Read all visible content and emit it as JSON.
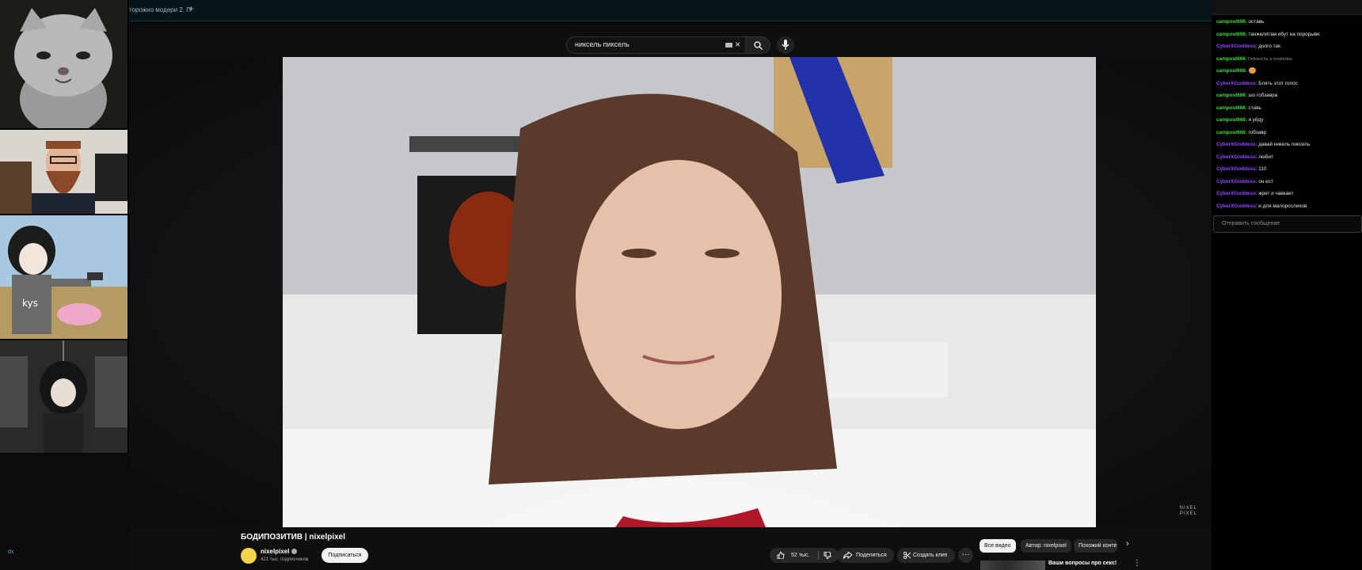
{
  "browser": {
    "tab_label": "торожно модери 2. П",
    "tab_add": "+"
  },
  "header": {
    "search_value": "никсель пиксель",
    "clear_icon": "×"
  },
  "video": {
    "watermark_line1": "NIXEL",
    "watermark_line2": "PIXEL",
    "title": "БОДИПОЗИТИВ | nixelpixel"
  },
  "channel": {
    "name": "nixelpixel",
    "subscribers": "421 тыс. подписчиков",
    "subscribe_label": "Подписаться"
  },
  "actions": {
    "like_count": "52 тыс.",
    "share_label": "Поделиться",
    "clip_label": "Создать клип",
    "more_label": "···"
  },
  "recommend": {
    "chips": [
      "Все видео",
      "Автор: nixelpixel",
      "Похожий конте"
    ],
    "next_icon": "›",
    "item_title": "Ваши вопросы про секс!",
    "item_menu": "⋮"
  },
  "chat": {
    "messages": [
      {
        "author": "campost666",
        "text": ": оставь"
      },
      {
        "author": "campost666",
        "text": ": танжелятам ебут на порорыве"
      },
      {
        "author": "CyberXGoddess",
        "text": ": долго так"
      },
      {
        "author": "campost666",
        "text": ": Deleted by a moderator",
        "deleted": true
      },
      {
        "author": "campost666",
        "text": ": ",
        "emote": true
      },
      {
        "author": "CyberXGoddess",
        "text": ": Блять этот голос"
      },
      {
        "author": "campost666",
        "text": ": шо гобзавра"
      },
      {
        "author": "campost666",
        "text": ": ставь"
      },
      {
        "author": "campost666",
        "text": ": я уйду"
      },
      {
        "author": "campost666",
        "text": ": гобзавр"
      },
      {
        "author": "CyberXGoddess",
        "text": ": давай никель пиксель"
      },
      {
        "author": "CyberXGoddess",
        "text": ": любит"
      },
      {
        "author": "CyberXGoddess",
        "text": ": 110"
      },
      {
        "author": "CyberXGoddess",
        "text": ": он ест"
      },
      {
        "author": "CyberXGoddess",
        "text": ": жрет и чавкает"
      },
      {
        "author": "CyberXGoddess",
        "text": ": и для малорослихов"
      }
    ],
    "input_placeholder": "Отправить сообщение"
  },
  "edge": {
    "label": "dx"
  },
  "colors": {
    "chat_green": "#3ae03a",
    "chat_purple": "#9147ff",
    "yt_bg": "#0f0f0f"
  }
}
